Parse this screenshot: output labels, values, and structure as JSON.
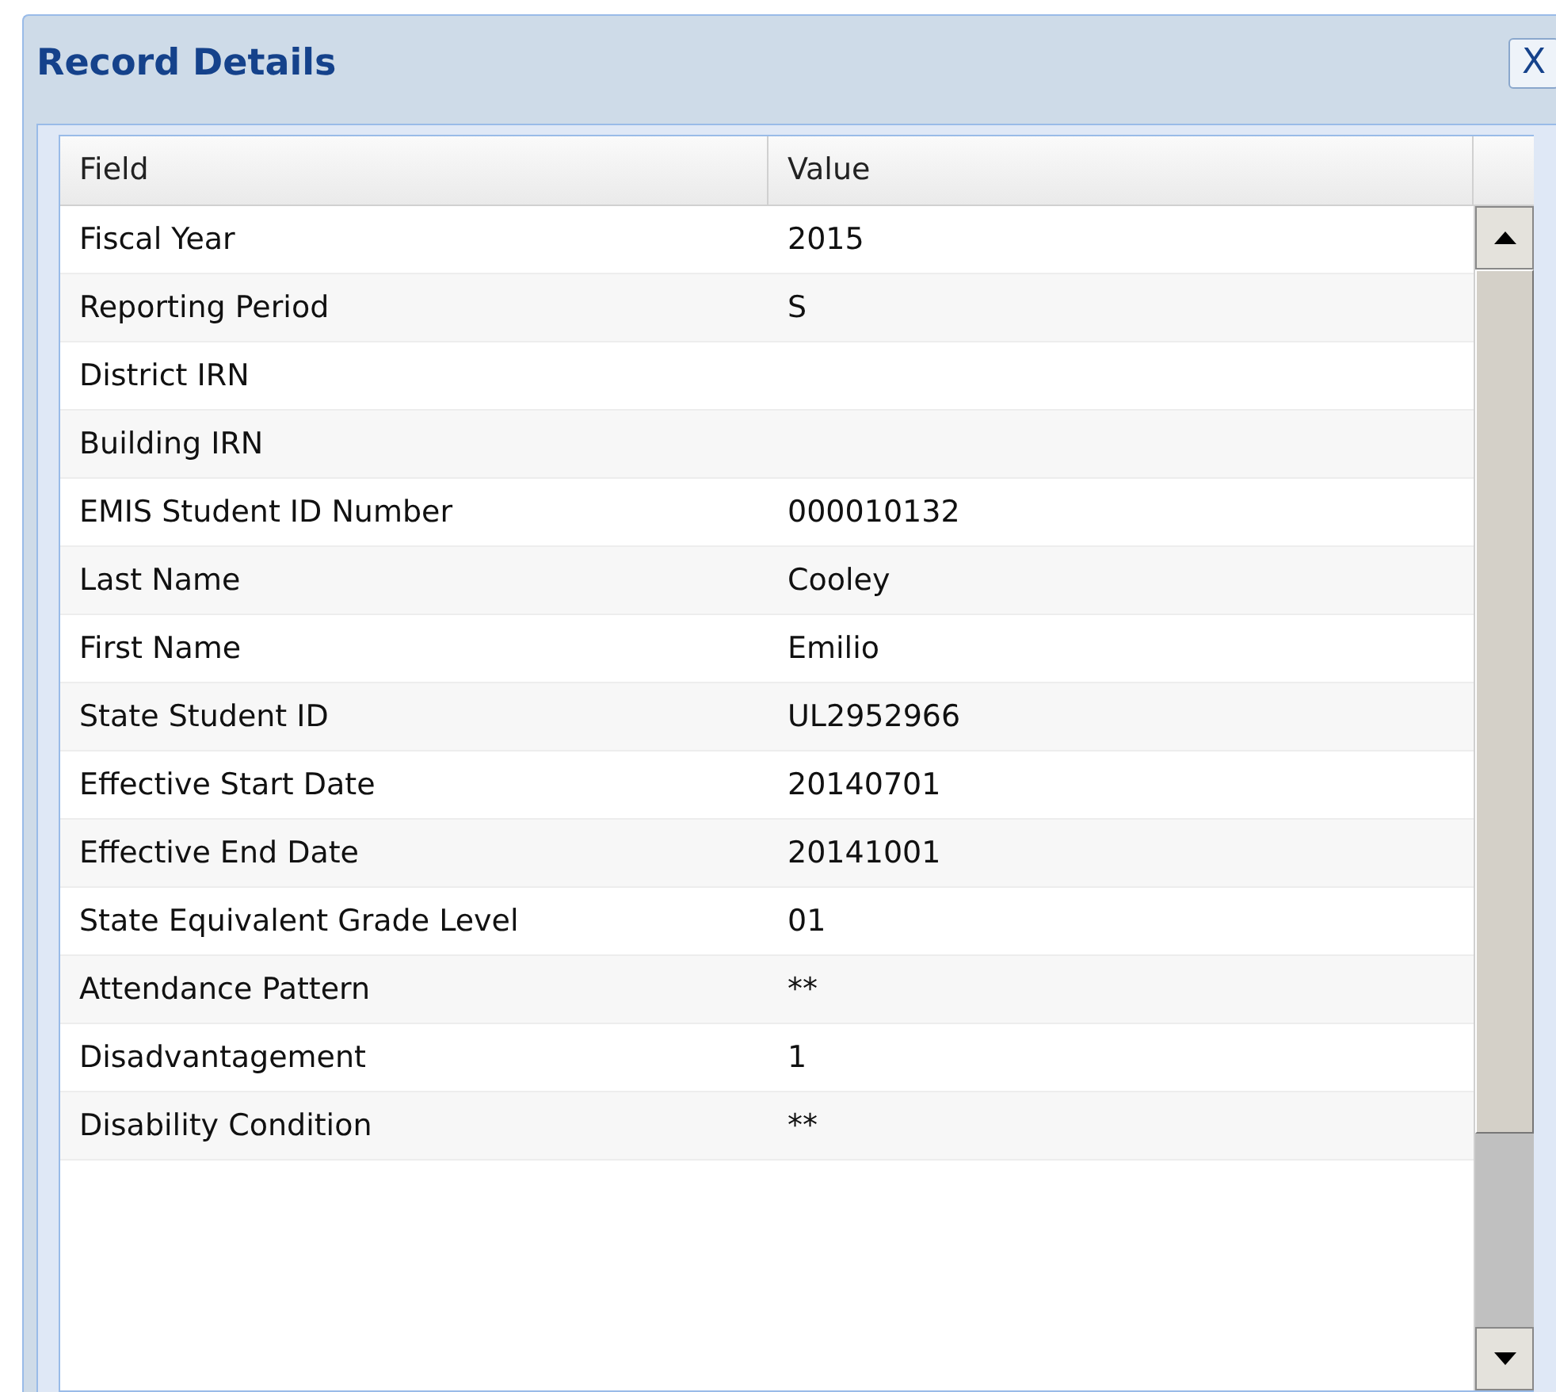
{
  "dialog": {
    "title": "Record Details",
    "close_icon": "X"
  },
  "table": {
    "columns": [
      "Field",
      "Value"
    ],
    "rows": [
      {
        "field": "Fiscal Year",
        "value": "2015"
      },
      {
        "field": "Reporting Period",
        "value": "S"
      },
      {
        "field": "District IRN"
      },
      {
        "field": "Building IRN"
      },
      {
        "field": "EMIS Student ID Number",
        "value": "000010132"
      },
      {
        "field": "Last Name",
        "value": "Cooley"
      },
      {
        "field": "First Name",
        "value": "Emilio"
      },
      {
        "field": "State Student ID",
        "value": "UL2952966"
      },
      {
        "field": "Effective Start Date",
        "value": "20140701"
      },
      {
        "field": "Effective End Date",
        "value": "20141001"
      },
      {
        "field": "State Equivalent Grade Level",
        "value": "01"
      },
      {
        "field": "Attendance Pattern",
        "value": "**"
      },
      {
        "field": "Disadvantagement",
        "value": "1"
      },
      {
        "field": "Disability Condition",
        "value": "**"
      }
    ]
  }
}
